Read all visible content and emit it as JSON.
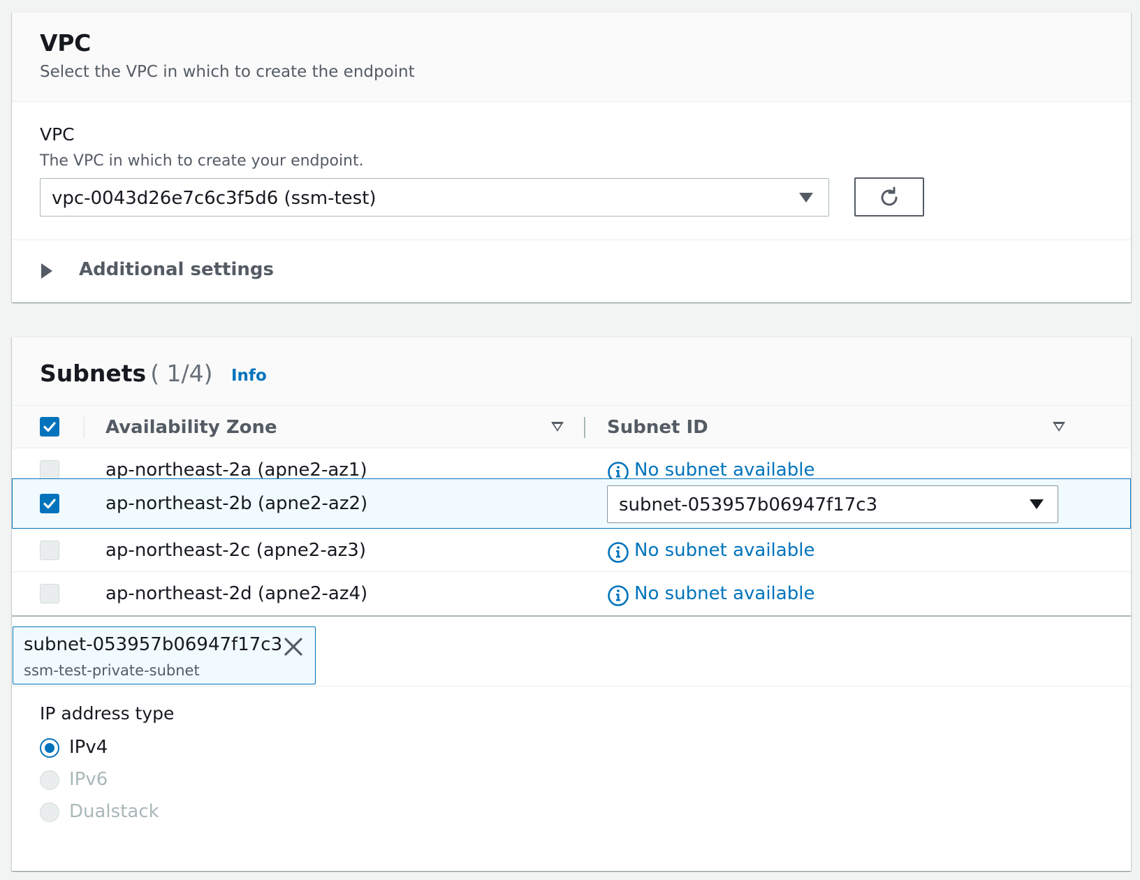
{
  "vpc_section": {
    "title": "VPC",
    "description": "Select the VPC in which to create the endpoint",
    "field_label": "VPC",
    "field_description": "The VPC in which to create your endpoint.",
    "selected_vpc": "vpc-0043d26e7c6c3f5d6 (ssm-test)",
    "additional_settings_label": "Additional settings"
  },
  "subnets_section": {
    "title": "Subnets",
    "count": "( 1/4)",
    "info_label": "Info",
    "columns": {
      "availability_zone": "Availability Zone",
      "subnet_id": "Subnet ID"
    },
    "rows": [
      {
        "az": "ap-northeast-2a (apne2-az1)",
        "subnet": "No subnet available",
        "checked": false
      },
      {
        "az": "ap-northeast-2b (apne2-az2)",
        "subnet": "subnet-053957b06947f17c3",
        "checked": true
      },
      {
        "az": "ap-northeast-2c (apne2-az3)",
        "subnet": "No subnet available",
        "checked": false
      },
      {
        "az": "ap-northeast-2d (apne2-az4)",
        "subnet": "No subnet available",
        "checked": false
      }
    ],
    "selected_token": {
      "id": "subnet-053957b06947f17c3",
      "name": "ssm-test-private-subnet"
    }
  },
  "ip_address_type": {
    "label": "IP address type",
    "options": [
      {
        "label": "IPv4",
        "selected": true,
        "disabled": false
      },
      {
        "label": "IPv6",
        "selected": false,
        "disabled": true
      },
      {
        "label": "Dualstack",
        "selected": false,
        "disabled": true
      }
    ]
  },
  "colors": {
    "accent": "#0073bb",
    "text": "#16191f",
    "secondary_text": "#545b64",
    "disabled": "#aab7b8",
    "selected_row_bg": "#f1faff"
  },
  "icons": [
    "refresh-icon",
    "caret-down-icon",
    "caret-right-icon",
    "sort-caret-icon",
    "check-icon",
    "info-icon",
    "close-icon"
  ]
}
